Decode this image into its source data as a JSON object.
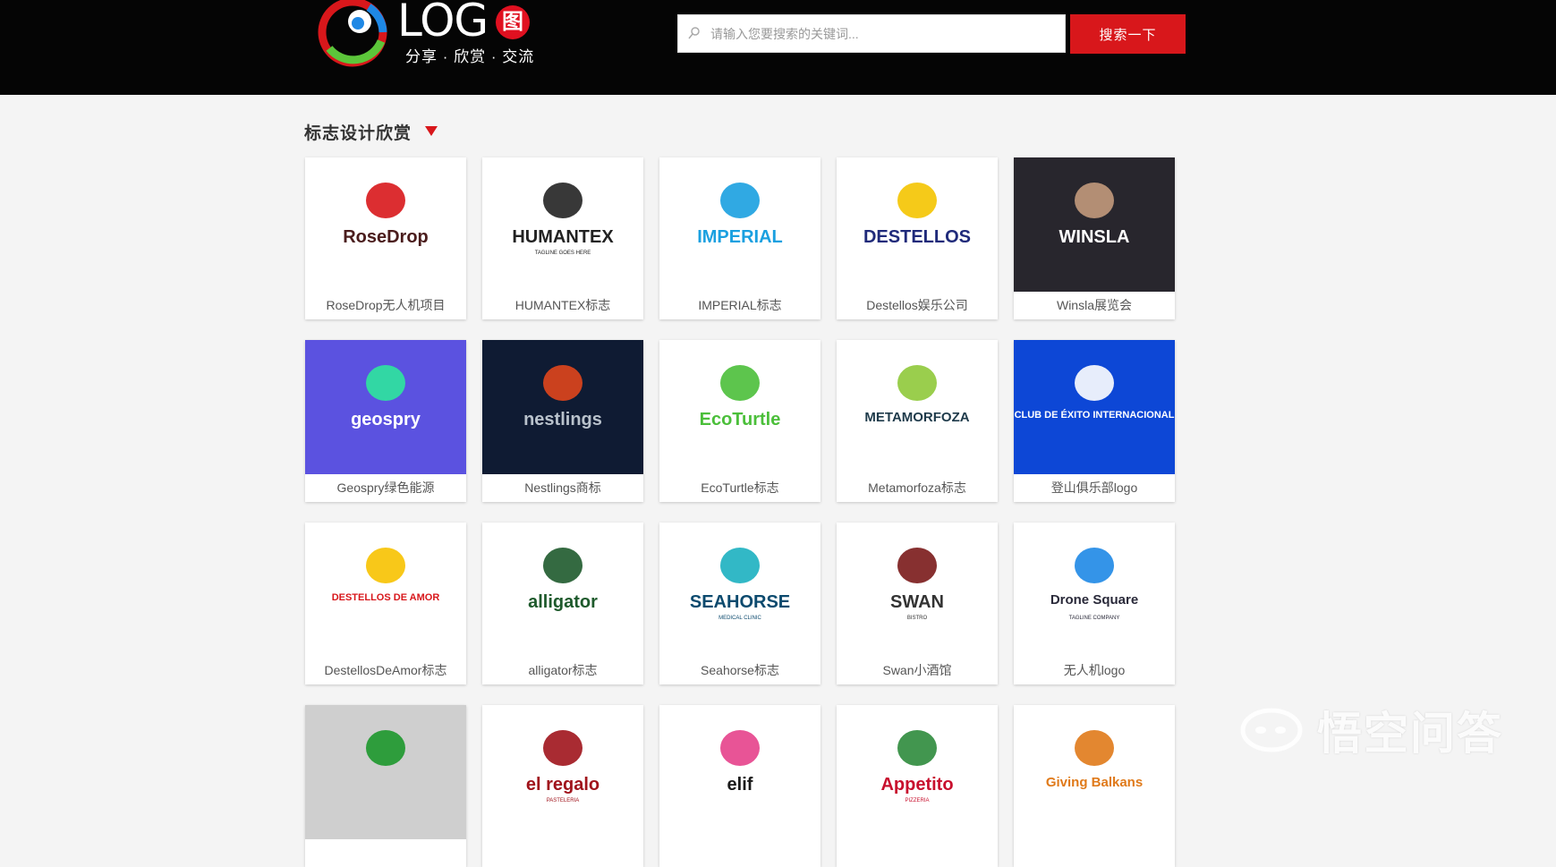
{
  "header": {
    "logo_text": "LOG",
    "logo_seal_char": "图",
    "slogan": "分享 · 欣赏 · 交流",
    "search_placeholder": "请输入您要搜索的关键词...",
    "search_button": "搜索一下"
  },
  "section": {
    "title": "标志设计欣赏"
  },
  "cards": [
    {
      "caption": "RoseDrop无人机项目",
      "brand": "RoseDrop",
      "bg": "#ffffff",
      "fg": "#4a1c1c",
      "accent": "#d8171b"
    },
    {
      "caption": "HUMANTEX标志",
      "brand": "HUMANTEX",
      "sub": "TAGLINE GOES HERE",
      "bg": "#ffffff",
      "fg": "#222222"
    },
    {
      "caption": "IMPERIAL标志",
      "brand": "IMPERIAL",
      "bg": "#ffffff",
      "fg": "#1aa0e0"
    },
    {
      "caption": "Destellos娱乐公司",
      "brand": "DESTELLOS",
      "bg": "#ffffff",
      "fg": "#1f2a7a",
      "accent": "#f4c400"
    },
    {
      "caption": "Winsla展览会",
      "brand": "WINSLA",
      "bg": "#28262d",
      "fg": "#ffffff",
      "accent": "#c29a7c"
    },
    {
      "caption": "Geospry绿色能源",
      "brand": "geospry",
      "bg": "#5b52e0",
      "fg": "#ffffff",
      "accent": "#2ee59d"
    },
    {
      "caption": "Nestlings商标",
      "brand": "nestlings",
      "bg": "#0f1b33",
      "fg": "#b9c2cc",
      "accent": "#e0461c"
    },
    {
      "caption": "EcoTurtle标志",
      "brand": "EcoTurtle",
      "bg": "#ffffff",
      "fg": "#4bbf3a"
    },
    {
      "caption": "Metamorfoza标志",
      "brand": "METAMORFOZA",
      "bg": "#ffffff",
      "fg": "#1e3a4a",
      "accent": "#8fc93a"
    },
    {
      "caption": "登山俱乐部logo",
      "brand": "CLUB DE ÉXITO INTERNACIONAL",
      "bg": "#0d47d6",
      "fg": "#ffffff"
    },
    {
      "caption": "DestellosDeAmor标志",
      "brand": "DESTELLOS DE AMOR",
      "bg": "#ffffff",
      "fg": "#d8171b",
      "accent": "#f7c200"
    },
    {
      "caption": "alligator标志",
      "brand": "alligator",
      "bg": "#ffffff",
      "fg": "#1e5a2c"
    },
    {
      "caption": "Seahorse标志",
      "brand": "SEAHORSE",
      "sub": "MEDICAL CLINIC",
      "bg": "#ffffff",
      "fg": "#0c4a6e",
      "accent": "#1cb0c0"
    },
    {
      "caption": "Swan小酒馆",
      "brand": "SWAN",
      "sub": "BISTRO",
      "bg": "#ffffff",
      "fg": "#333333",
      "accent": "#7a1a1a"
    },
    {
      "caption": "无人机logo",
      "brand": "Drone Square",
      "sub": "TAGLINE COMPANY",
      "bg": "#ffffff",
      "fg": "#2a2a3a",
      "accent": "#1e88e5"
    },
    {
      "caption": "",
      "brand": "",
      "bg": "#cfcfcf",
      "fg": "#0d3b8a",
      "accent": "#2e9d3c"
    },
    {
      "caption": "",
      "brand": "el regalo",
      "sub": "PASTELERIA",
      "bg": "#ffffff",
      "fg": "#a0141c"
    },
    {
      "caption": "",
      "brand": "elif",
      "bg": "#ffffff",
      "fg": "#1a1a1a",
      "accent": "#e6418b"
    },
    {
      "caption": "",
      "brand": "Appetito",
      "sub": "PIZZERIA",
      "bg": "#ffffff",
      "fg": "#c8102e",
      "accent": "#2e8b3c"
    },
    {
      "caption": "",
      "brand": "Giving Balkans",
      "bg": "#ffffff",
      "fg": "#e07a1a"
    }
  ],
  "watermark": {
    "text": "悟空问答"
  }
}
